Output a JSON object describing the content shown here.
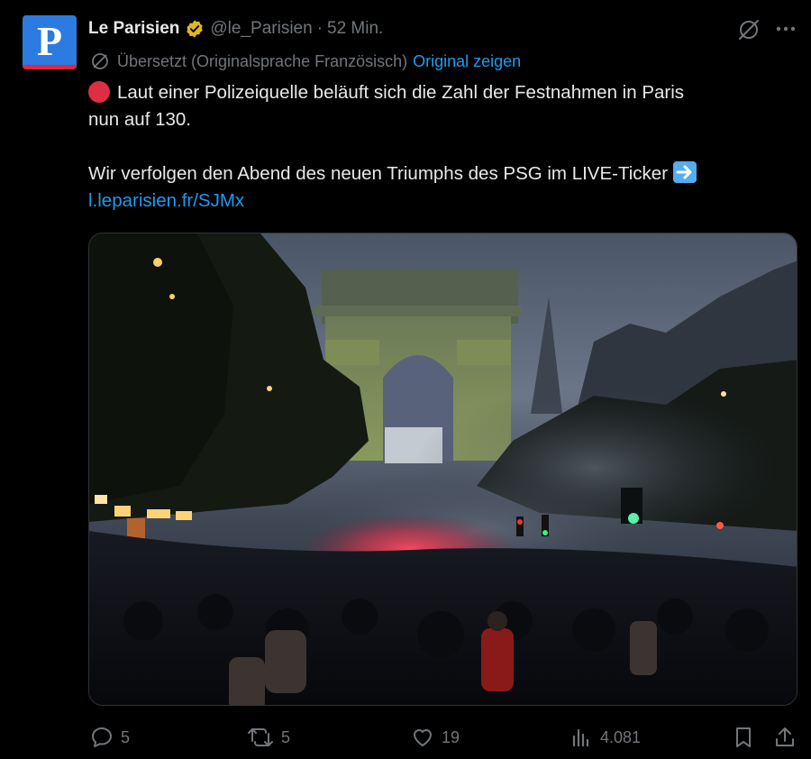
{
  "tweet": {
    "author_name": "Le Parisien",
    "handle": "@le_Parisien",
    "separator": "·",
    "time": "52 Min.",
    "avatar_letter": "P",
    "verified_color": "#e2b719",
    "translation": {
      "label": "Übersetzt (Originalsprache Französisch)",
      "show_original": "Original zeigen"
    },
    "text_line1": "Laut einer Polizeiquelle beläuft sich die Zahl der Festnahmen in Paris",
    "text_line2": "nun auf 130.",
    "text_line3": "Wir verfolgen den Abend des neuen Triumphs des PSG im LIVE-Ticker",
    "link": "l.leparisien.fr/SJMx",
    "media_description_icon": "photo-arc-de-triomphe-crowd"
  },
  "actions": {
    "replies": "5",
    "retweets": "5",
    "likes": "19",
    "views": "4.081"
  },
  "icons": {
    "reply": "reply-icon",
    "retweet": "retweet-icon",
    "like": "heart-icon",
    "views": "views-icon",
    "bookmark": "bookmark-icon",
    "share": "share-icon",
    "grok": "grok-icon",
    "more": "more-icon",
    "translate": "translate-icon"
  },
  "colors": {
    "background": "#000000",
    "text": "#e7e9ea",
    "muted": "#71767b",
    "link": "#1d9bf0",
    "avatar": "#2c7be0"
  }
}
